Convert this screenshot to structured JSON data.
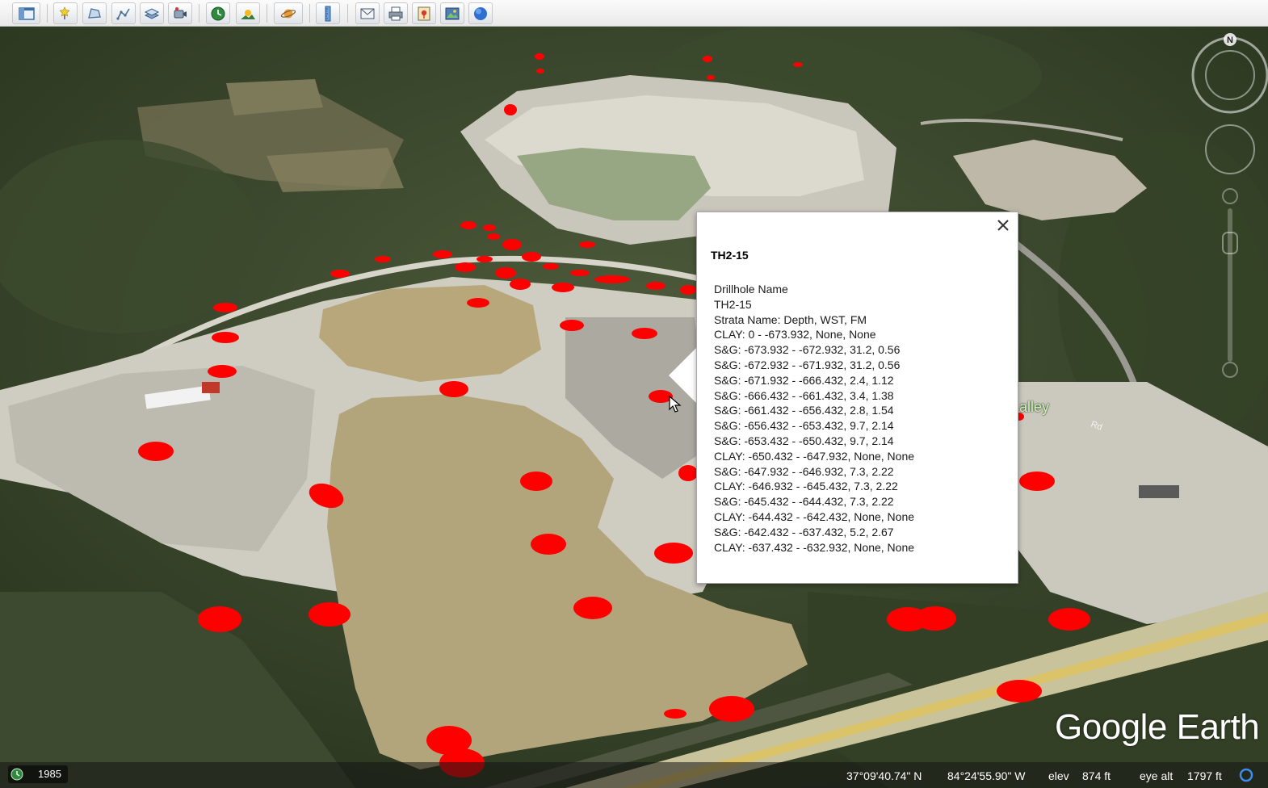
{
  "toolbar": {
    "buttons": [
      {
        "icon": "sidebar-toggle-icon"
      },
      {
        "icon": "add-placemark-icon"
      },
      {
        "icon": "add-polygon-icon"
      },
      {
        "icon": "add-path-icon"
      },
      {
        "icon": "add-overlay-icon"
      },
      {
        "icon": "record-tour-icon"
      },
      {
        "icon": "historical-imagery-icon"
      },
      {
        "icon": "sunlight-icon"
      },
      {
        "icon": "planets-icon"
      },
      {
        "icon": "ruler-icon"
      },
      {
        "icon": "email-icon"
      },
      {
        "icon": "print-icon"
      },
      {
        "icon": "save-image-icon"
      },
      {
        "icon": "view-in-maps-icon"
      },
      {
        "icon": "earth-icon"
      }
    ]
  },
  "popup": {
    "title": "TH2-15",
    "lines": [
      "Drillhole Name",
      "TH2-15",
      "Strata Name: Depth, WST, FM",
      "CLAY: 0 - -673.932, None, None",
      "S&G: -673.932 - -672.932, 31.2, 0.56",
      "S&G: -672.932 - -671.932, 31.2, 0.56",
      "S&G: -671.932 - -666.432, 2.4, 1.12",
      "S&G: -666.432 - -661.432, 3.4, 1.38",
      "S&G: -661.432 - -656.432, 2.8, 1.54",
      "S&G: -656.432 - -653.432, 9.7, 2.14",
      "S&G: -653.432 - -650.432, 9.7, 2.14",
      "CLAY: -650.432 - -647.932, None, None",
      "S&G: -647.932 - -646.932, 7.3, 2.22",
      "CLAY: -646.932 - -645.432, 7.3, 2.22",
      "S&G: -645.432 - -644.432, 7.3, 2.22",
      "CLAY: -644.432 - -642.432, None, None",
      "S&G: -642.432 - -637.432, 5.2, 2.67",
      "CLAY: -637.432 - -632.932, None, None"
    ]
  },
  "map": {
    "place_label": "alley",
    "watermark": "Google Earth",
    "compass_label": "N",
    "marker_color": "#ff0000"
  },
  "status": {
    "year": "1985",
    "latitude": "37°09'40.74\" N",
    "longitude": "84°24'55.90\" W",
    "elev_label": "elev",
    "elev_value": "874 ft",
    "eye_alt_label": "eye alt",
    "eye_alt_value": "1797 ft"
  }
}
